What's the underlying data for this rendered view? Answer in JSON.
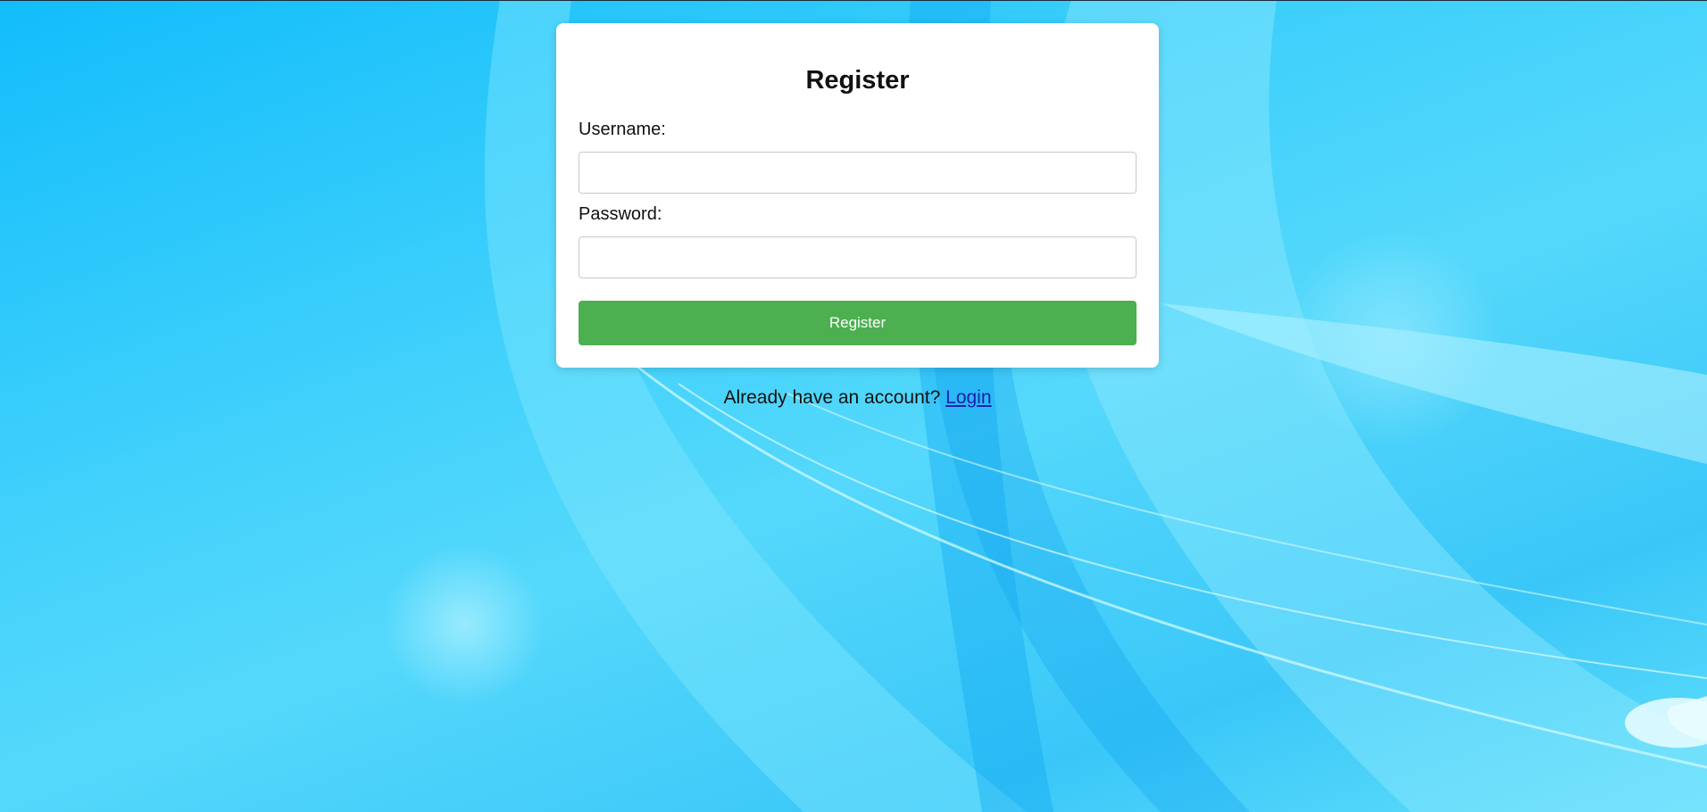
{
  "form": {
    "title": "Register",
    "username_label": "Username:",
    "username_value": "",
    "password_label": "Password:",
    "password_value": "",
    "submit_label": "Register"
  },
  "footer": {
    "prompt_text": "Already have an account?",
    "login_link": "Login"
  },
  "colors": {
    "background_primary": "#12bdfb",
    "button": "#4caf50",
    "link": "#1a1fb3"
  }
}
